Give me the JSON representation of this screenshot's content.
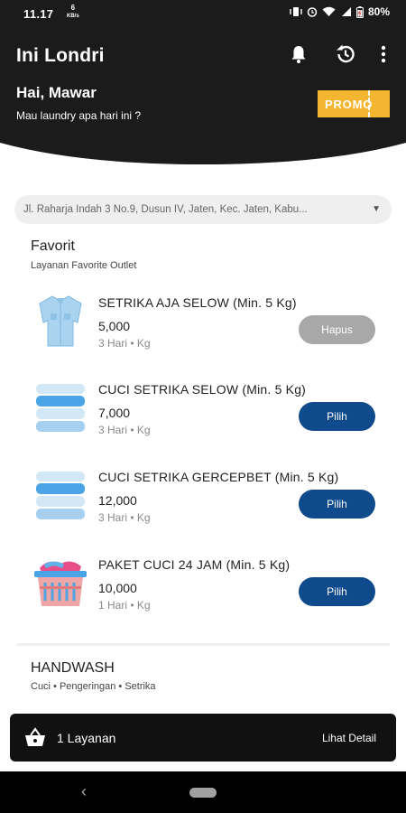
{
  "status": {
    "time": "11.17",
    "speed_value": "6",
    "speed_unit": "KB/s",
    "battery": "80%"
  },
  "header": {
    "title": "Ini Londri",
    "greeting": "Hai, Mawar",
    "subgreeting": "Mau laundry apa hari ini ?",
    "promo_label": "PROMO"
  },
  "address": {
    "text": "Jl. Raharja Indah 3 No.9, Dusun IV, Jaten, Kec. Jaten, Kabu..."
  },
  "favorite": {
    "title": "Favorit",
    "subtitle": "Layanan Favorite Outlet",
    "items": [
      {
        "name": "SETRIKA AJA SELOW (Min. 5 Kg)",
        "price": "5,000",
        "duration": "3 Hari • Kg",
        "button": "Hapus",
        "icon": "shirt-icon"
      },
      {
        "name": "CUCI SETRIKA SELOW (Min. 5 Kg)",
        "price": "7,000",
        "duration": "3 Hari • Kg",
        "button": "Pilih",
        "icon": "folded-towels-icon"
      },
      {
        "name": "CUCI SETRIKA GERCEPBET (Min. 5 Kg)",
        "price": "12,000",
        "duration": "3 Hari • Kg",
        "button": "Pilih",
        "icon": "folded-towels-icon"
      },
      {
        "name": "PAKET CUCI 24 JAM (Min. 5 Kg)",
        "price": "10,000",
        "duration": "1 Hari • Kg",
        "button": "Pilih",
        "icon": "laundry-basket-icon"
      }
    ]
  },
  "handwash": {
    "title": "HANDWASH",
    "subtitle": "Cuci • Pengeringan • Setrika"
  },
  "cart": {
    "count_label": "1 Layanan",
    "detail_label": "Lihat Detail"
  },
  "colors": {
    "header_bg": "#1b1b1b",
    "promo": "#f4b531",
    "primary_button": "#0e4a8c",
    "disabled_button": "#a8a8a8"
  }
}
